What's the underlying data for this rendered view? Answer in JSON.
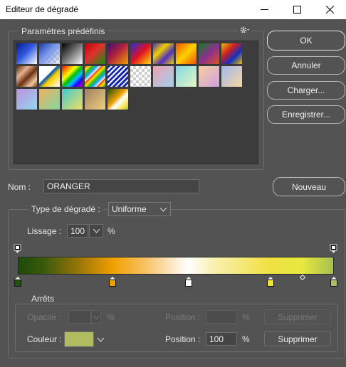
{
  "window": {
    "title": "Editeur de dégradé",
    "minimize": "—",
    "maximize": "☐",
    "close": "✕"
  },
  "presets": {
    "title": "Paramètres prédéfinis",
    "gear_icon": "gear-icon",
    "swatches": [
      {
        "bg": "linear-gradient(135deg,#0a1a8a 0%,#2e58e0 45%,#ffffff 100%)"
      },
      {
        "bg": "linear-gradient(135deg,#1a3aa0 0%,#6f8fe8 40%,rgba(255,255,255,0) 100%)",
        "checker": true
      },
      {
        "bg": "linear-gradient(135deg,#000000 0%,#777777 50%,#ffffff 100%)"
      },
      {
        "bg": "linear-gradient(135deg,#c00000 0%,#e03030 45%,#0e8f0e 100%)"
      },
      {
        "bg": "linear-gradient(135deg,#3a1070 0%,#b02040 45%,#f0a000 100%)"
      },
      {
        "bg": "linear-gradient(135deg,#2030d0 0%,#e01020 50%,#ffe000 100%)"
      },
      {
        "bg": "linear-gradient(135deg,#5030c0 0%,#f0d000 35%,#5030c0 65%,#f0d000 100%)"
      },
      {
        "bg": "linear-gradient(135deg,#f05000 0%,#ffd000 50%,#f05000 100%)"
      },
      {
        "bg": "linear-gradient(135deg,#108020 0%,#8a3090 50%,#e05020 100%)"
      },
      {
        "bg": "linear-gradient(135deg,#f0c000 0%,#d02020 35%,#1030c0 65%,#f0c000 100%)"
      },
      {
        "bg": "linear-gradient(135deg,#5a2a10 0%,#e8b090 30%,#6a3010 55%,#f0c8a0 80%,#7a3a10 100%)"
      },
      {
        "bg": "linear-gradient(135deg,#ffffff 0%,#ffffff 40%,#0050b0 45%,#ffd000 60%,#ffffff 100%)"
      },
      {
        "bg": "linear-gradient(135deg,#ff0000 0%,#ff9900 20%,#ffff00 35%,#00c000 50%,#00c0ff 65%,#2000ff 80%,#c000c0 100%)"
      },
      {
        "bg": "repeating-linear-gradient(135deg,#ff2020 0px,#ffe000 4px,#20c020 8px,#20a0ff 12px,#ffffff 16px)"
      },
      {
        "bg": "repeating-linear-gradient(135deg,#1a2ab0 0px,#1a2ab0 3px,#ffffff 3px,#ffffff 5px)"
      },
      {
        "bg": "",
        "checker": true
      },
      {
        "bg": "linear-gradient(135deg,#f0a0b0 0%,#a0d0f0 100%)"
      },
      {
        "bg": "linear-gradient(135deg,#80d8e8 0%,#e8f8c0 100%)"
      },
      {
        "bg": "linear-gradient(135deg,#f8d0a0 0%,#d0a0e0 100%)"
      },
      {
        "bg": "linear-gradient(135deg,#a0b8f0 0%,#f8d8a0 100%)"
      },
      {
        "bg": "linear-gradient(135deg,#c090e0 0%,#90d8f0 100%)"
      },
      {
        "bg": "linear-gradient(135deg,#f0b060 0%,#80d8a0 100%)"
      },
      {
        "bg": "linear-gradient(135deg,#40c8d0 0%,#f0e060 100%)"
      },
      {
        "bg": "linear-gradient(135deg,#a08060 0%,#f0d080 100%)"
      },
      {
        "bg": "linear-gradient(135deg,#1a5010 0%,#f0a000 45%,#ffffff 60%,#f0e040 85%,#a0c050 100%)"
      }
    ]
  },
  "buttons": {
    "ok": "OK",
    "cancel": "Annuler",
    "load": "Charger...",
    "save": "Enregistrer...",
    "new": "Nouveau"
  },
  "name": {
    "label": "Nom :",
    "value": "ORANGER"
  },
  "gradient_type": {
    "label": "Type de dégradé :",
    "value": "Uniforme"
  },
  "smoothness": {
    "label": "Lissage :",
    "value": "100",
    "unit": "%"
  },
  "gradient": {
    "css": "linear-gradient(90deg,#1d4a0b 0%,#3a5a0a 8%,#a07808 20%,#f0a000 30%,#f8c060 40%,#ffffff 54%,#f8f0b0 62%,#f0e040 80%,#e8e840 90%,#a8c050 100%)",
    "color_stops": [
      {
        "color": "#1f5510",
        "location": 0
      },
      {
        "color": "#f0a000",
        "location": 30
      },
      {
        "color": "#ffffff",
        "location": 54
      },
      {
        "color": "#f0e040",
        "location": 80
      },
      {
        "color": "#a8c060",
        "location": 100
      }
    ],
    "midpoint": 90,
    "opacity_stops": [
      {
        "color": "#ffffff",
        "location": 0
      },
      {
        "color": "#ffffff",
        "location": 100
      }
    ]
  },
  "stops": {
    "title": "Arrêts",
    "opacity_label": "Opacité :",
    "opacity_value": "",
    "opacity_unit": "%",
    "position_label": "Position :",
    "position_value_top": "",
    "position_unit": "%",
    "delete_label": "Supprimer",
    "color_label": "Couleur :",
    "color_value": "#b1bb5f",
    "position_value": "100",
    "position_unit_bottom": "%"
  }
}
